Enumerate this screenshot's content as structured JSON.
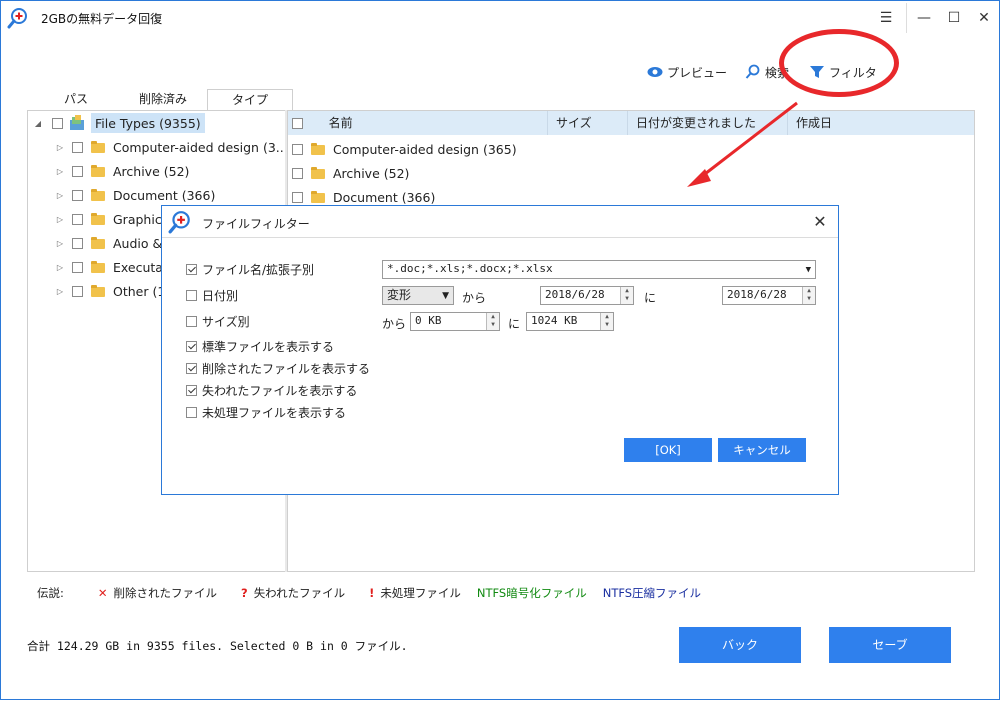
{
  "window": {
    "title": "2GBの無料データ回復"
  },
  "toolbar": {
    "preview": "プレビュー",
    "search": "検索",
    "filter": "フィルタ"
  },
  "tabs": [
    "パス",
    "削除済み",
    "タイプ"
  ],
  "tree": {
    "root": "File Types (9355)",
    "items": [
      "Computer-aided design (3...",
      "Archive (52)",
      "Document (366)",
      "Graphics",
      "Audio &",
      "Executab",
      "Other (1"
    ]
  },
  "columns": [
    "名前",
    "サイズ",
    "日付が変更されました",
    "作成日"
  ],
  "files": [
    "Computer-aided design (365)",
    "Archive (52)",
    "Document (366)"
  ],
  "legend": {
    "label": "伝説:",
    "deleted": "削除されたファイル",
    "lost": "失われたファイル",
    "raw": "未処理ファイル",
    "ntfs_encrypted": "NTFS暗号化ファイル",
    "ntfs_compressed": "NTFS圧縮ファイル",
    "colors": {
      "deleted": "#e0201e",
      "lost": "#e0201e",
      "raw": "#e0201e",
      "encrypted": "#118a11",
      "compressed": "#1a2fa0"
    }
  },
  "status": "合計 124.29 GB in 9355 files. Selected 0 B in 0 ファイル.",
  "buttons": {
    "back": "バック",
    "save": "セーブ"
  },
  "dialog": {
    "title": "ファイルフィルター",
    "filename_label": "ファイル名/拡張子別",
    "filename_value": "*.doc;*.xls;*.docx;*.xlsx",
    "date_label": "日付別",
    "date_mode": "変形",
    "kara": "から",
    "date_from": "2018/6/28",
    "ni": "に",
    "date_to": "2018/6/28",
    "size_label": "サイズ別",
    "size_from": "0 KB",
    "size_to": "1024 KB",
    "show_normal": "標準ファイルを表示する",
    "show_deleted": "削除されたファイルを表示する",
    "show_lost": "失われたファイルを表示する",
    "show_raw": "未処理ファイルを表示する",
    "ok": "[OK]",
    "cancel": "キャンセル"
  },
  "accent": "#2f80ed"
}
